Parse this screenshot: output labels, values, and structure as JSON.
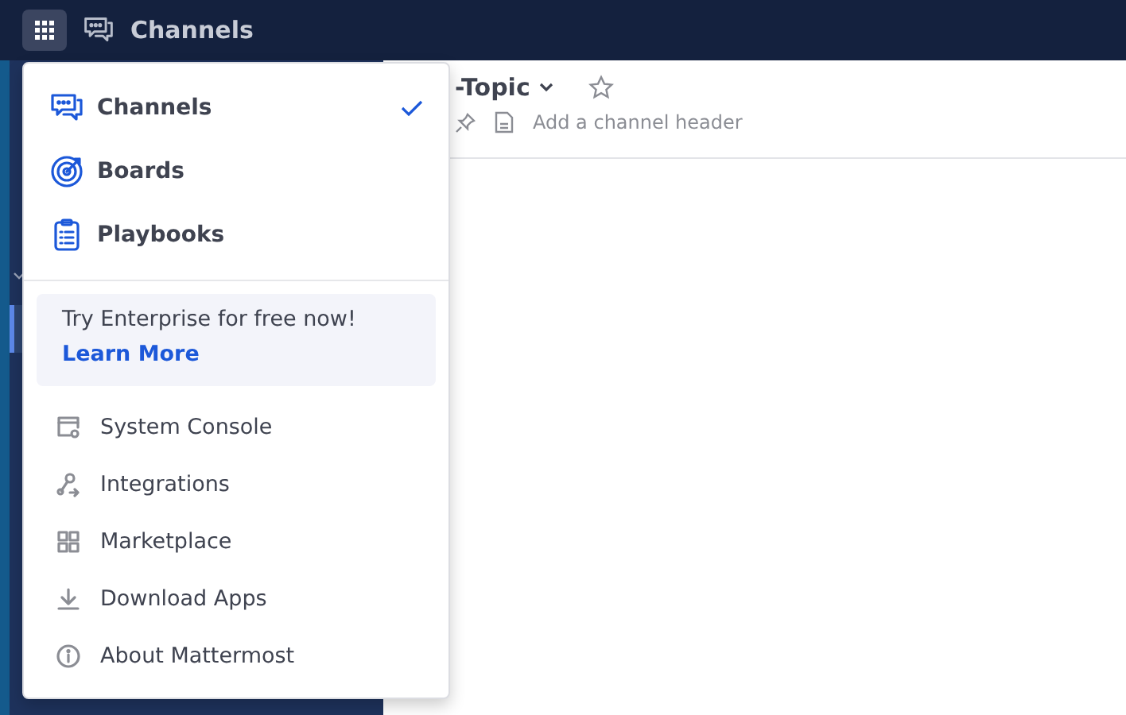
{
  "top_bar": {
    "product": "Channels"
  },
  "channel_header": {
    "name": "-Topic",
    "header_prompt": "Add a channel header"
  },
  "product_menu": {
    "products": [
      {
        "label": "Channels",
        "selected": true
      },
      {
        "label": "Boards",
        "selected": false
      },
      {
        "label": "Playbooks",
        "selected": false
      }
    ],
    "promo": {
      "text": "Try Enterprise for free now!",
      "link": "Learn More"
    },
    "items": [
      {
        "label": "System Console"
      },
      {
        "label": "Integrations"
      },
      {
        "label": "Marketplace"
      },
      {
        "label": "Download Apps"
      },
      {
        "label": "About Mattermost"
      }
    ]
  }
}
